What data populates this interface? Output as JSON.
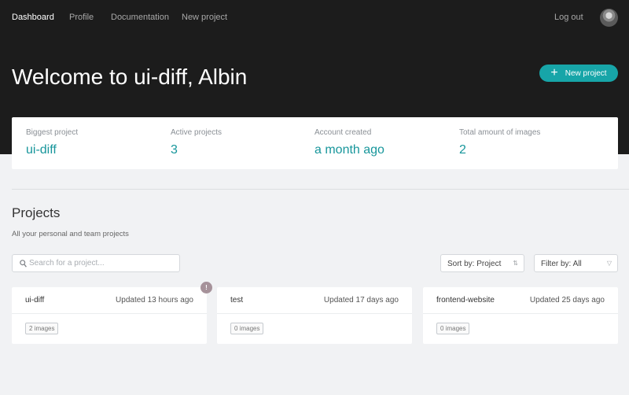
{
  "nav": {
    "links": [
      "Dashboard",
      "Profile",
      "Documentation",
      "New project"
    ],
    "logout": "Log out"
  },
  "header": {
    "welcome": "Welcome to ui-diff, Albin",
    "new_project_label": "New project"
  },
  "stats": [
    {
      "label": "Biggest project",
      "value": "ui-diff"
    },
    {
      "label": "Active projects",
      "value": "3"
    },
    {
      "label": "Account created",
      "value": "a month ago"
    },
    {
      "label": "Total amount of images",
      "value": "2"
    }
  ],
  "projects": {
    "title": "Projects",
    "subtitle": "All your personal and team projects",
    "search_placeholder": "Search for a project...",
    "sort_label": "Sort by: Project",
    "filter_label": "Filter by: All",
    "notification_badge": "!",
    "cards": [
      {
        "name": "ui-diff",
        "updated": "Updated 13 hours ago",
        "images": "2 images"
      },
      {
        "name": "test",
        "updated": "Updated 17 days ago",
        "images": "0 images"
      },
      {
        "name": "frontend-website",
        "updated": "Updated 25 days ago",
        "images": "0 images"
      }
    ]
  },
  "colors": {
    "accent": "#17a5a8",
    "hero_bg": "#1c1c1c",
    "page_bg": "#f1f2f4"
  }
}
